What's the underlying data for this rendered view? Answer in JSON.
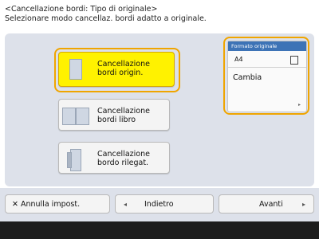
{
  "header": {
    "title": "<Cancellazione bordi: Tipo di originale>",
    "instruction": "Selezionare modo cancellaz. bordi adatto a originale."
  },
  "options": [
    {
      "line1": "Cancellazione",
      "line2": "bordi origin.",
      "selected": true
    },
    {
      "line1": "Cancellazione",
      "line2": "bordi libro",
      "selected": false
    },
    {
      "line1": "Cancellazione",
      "line2": "bordo rilegat.",
      "selected": false
    }
  ],
  "original_size": {
    "title": "Formato originale",
    "value": "A4",
    "change_label": "Cambia"
  },
  "bottom": {
    "reset_label": "Annulla impost.",
    "back_label": "Indietro",
    "next_label": "Avanti"
  },
  "colors": {
    "selected": "#fff200",
    "highlight_border": "#f0a500",
    "title_bar": "#3d73b6"
  }
}
